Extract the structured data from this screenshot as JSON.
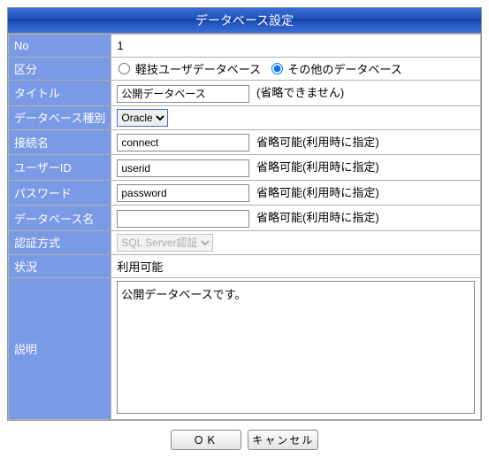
{
  "dialog_title": "データベース設定",
  "labels": {
    "no": "No",
    "division": "区分",
    "title_field": "タイトル",
    "db_type": "データベース種別",
    "connection": "接続名",
    "user_id": "ユーザーID",
    "password": "パスワード",
    "db_name": "データベース名",
    "auth_method": "認証方式",
    "status": "状況",
    "description": "説明"
  },
  "values": {
    "no": "1",
    "title_field": "公開データベース",
    "connection": "connect",
    "user_id": "userid",
    "password": "password",
    "db_name": "",
    "status": "利用可能",
    "description": "公開データベースです。"
  },
  "radio": {
    "opt1": "軽技ユーザデータベース",
    "opt2": "その他のデータベース",
    "selected": "opt2"
  },
  "selects": {
    "db_type_selected": "Oracle",
    "auth_selected": "SQL Server認証"
  },
  "hints": {
    "title_required": "(省略できません)",
    "optional": "省略可能(利用時に指定)"
  },
  "buttons": {
    "ok": "ＯＫ",
    "cancel": "キャンセル"
  }
}
